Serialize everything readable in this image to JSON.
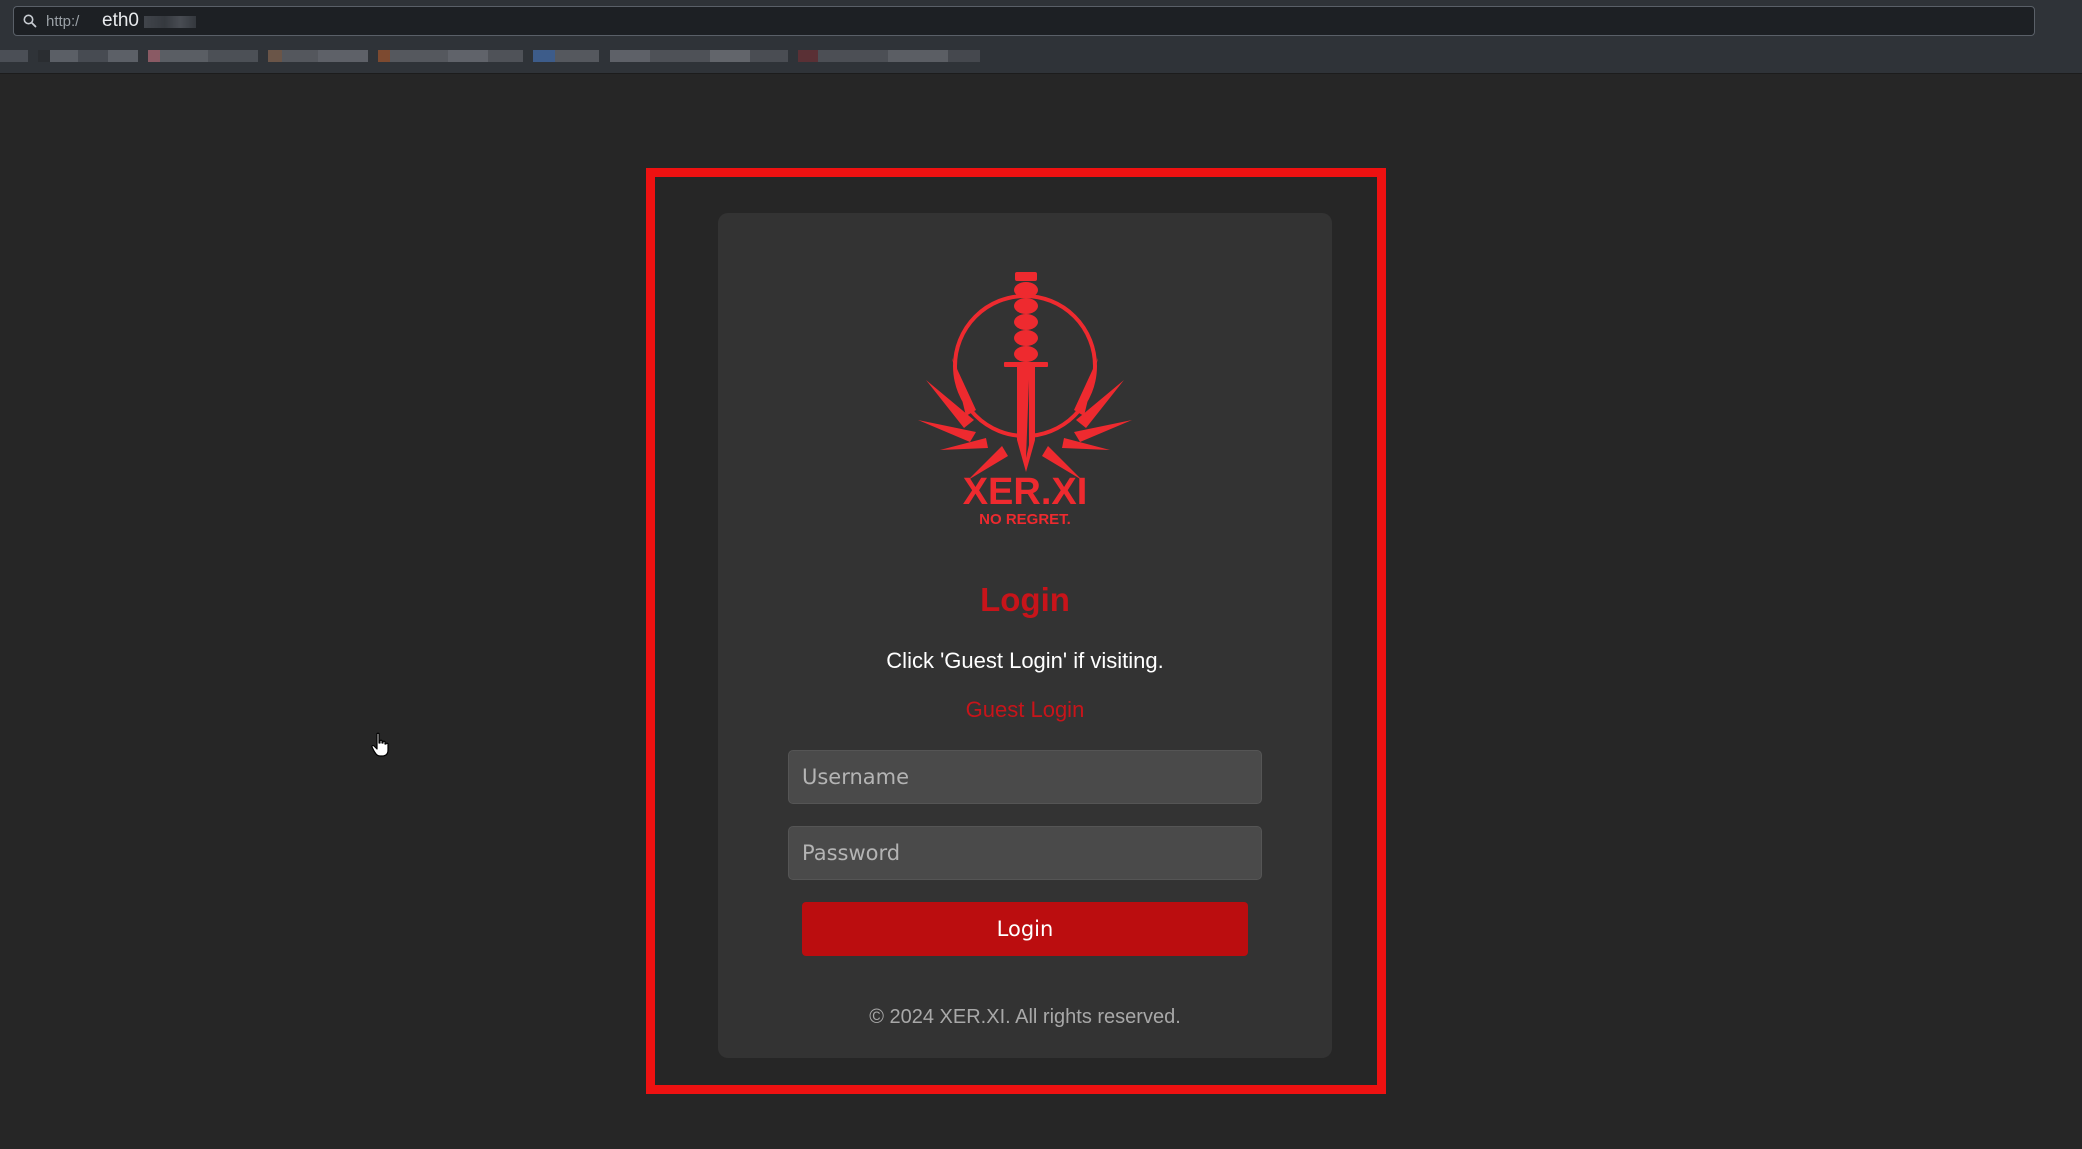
{
  "browser": {
    "url_prefix": "http:/",
    "url_host": "eth0"
  },
  "login": {
    "title": "Login",
    "subtitle": "Click 'Guest Login' if visiting.",
    "guest_link": "Guest Login",
    "username_placeholder": "Username",
    "password_placeholder": "Password",
    "submit_label": "Login",
    "footer": "© 2024 XER.XI. All rights reserved."
  },
  "logo": {
    "brand": "XER.XI",
    "tagline": "NO REGRET."
  },
  "colors": {
    "accent": "#c8141a",
    "button": "#bb0d0f",
    "highlight_frame": "#ee1111",
    "card": "#333333",
    "page_background": "#262626"
  },
  "icons": {
    "url_search": "search-icon",
    "cursor": "hand-pointer-icon"
  }
}
